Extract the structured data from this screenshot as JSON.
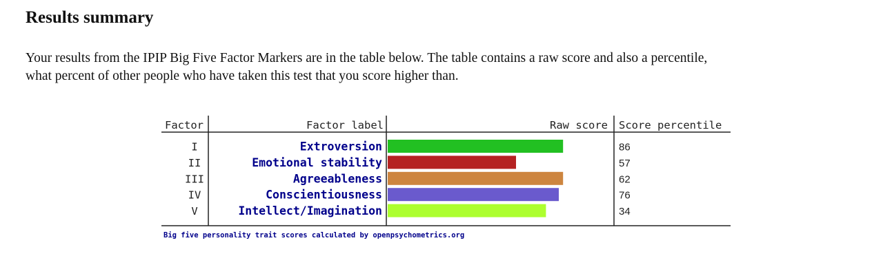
{
  "page": {
    "heading": "Results summary",
    "intro_line1": "Your results from the IPIP Big Five Factor Markers are in the table below. The table contains a raw score and also a percentile,",
    "intro_line2": "what percent of other people who have taken this test that you score higher than."
  },
  "chart_data": {
    "type": "bar",
    "orientation": "horizontal",
    "columns": {
      "factor": "Factor",
      "label": "Factor label",
      "raw": "Raw score",
      "percentile": "Score percentile"
    },
    "rows": [
      {
        "factor": "I",
        "label": "Extroversion",
        "raw": 41,
        "percentile": "86",
        "color": "#22c022"
      },
      {
        "factor": "II",
        "label": "Emotional stability",
        "raw": 30,
        "percentile": "57",
        "color": "#b52222"
      },
      {
        "factor": "III",
        "label": "Agreeableness",
        "raw": 41,
        "percentile": "62",
        "color": "#cd853f"
      },
      {
        "factor": "IV",
        "label": "Conscientiousness",
        "raw": 40,
        "percentile": "76",
        "color": "#6a5acd"
      },
      {
        "factor": "V",
        "label": "Intellect/Imagination",
        "raw": 37,
        "percentile": "34",
        "color": "#adff2f"
      }
    ],
    "xlim": [
      0,
      50
    ],
    "footer": "Big five personality trait scores calculated by openpsychometrics.org",
    "colors": {
      "label_text": "#00008b",
      "rule": "#222222"
    }
  }
}
